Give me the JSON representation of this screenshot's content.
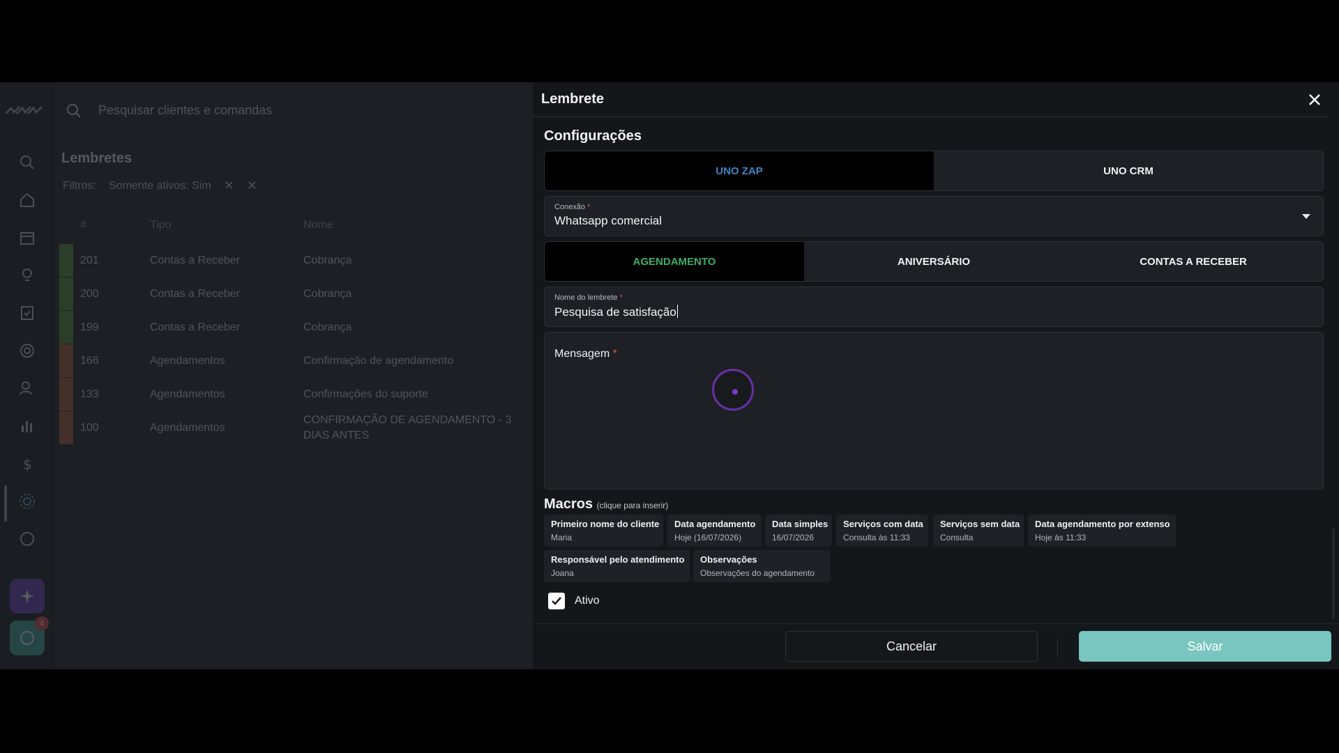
{
  "background": {
    "search_placeholder": "Pesquisar clientes e comandas",
    "page_title": "Lembretes",
    "filters_label": "Filtros:",
    "filter_chip": "Somente ativos: Sim",
    "notification_count": "4",
    "table": {
      "columns": [
        "#",
        "Tipo",
        "Nome"
      ],
      "rows": [
        {
          "id": "201",
          "type": "Contas a Receber",
          "name": "Cobrança",
          "color": "#4f8f3a"
        },
        {
          "id": "200",
          "type": "Contas a Receber",
          "name": "Cobrança",
          "color": "#4f8f3a"
        },
        {
          "id": "199",
          "type": "Contas a Receber",
          "name": "Cobrança",
          "color": "#4f8f3a"
        },
        {
          "id": "166",
          "type": "Agendamentos",
          "name": "Confirmação de agendamento",
          "color": "#b05a3c"
        },
        {
          "id": "133",
          "type": "Agendamentos",
          "name": "Confirmações do suporte",
          "color": "#b05a3c"
        },
        {
          "id": "100",
          "type": "Agendamentos",
          "name": "CONFIRMAÇÃO DE AGENDAMENTO - 3 DIAS ANTES",
          "color": "#b05a3c"
        }
      ]
    }
  },
  "drawer": {
    "title": "Lembrete",
    "section_title": "Configurações",
    "platform_tabs": [
      {
        "label": "UNO ZAP",
        "active": true
      },
      {
        "label": "UNO CRM",
        "active": false
      }
    ],
    "connection": {
      "label": "Conexão",
      "required_mark": "*",
      "value": "Whatsapp comercial"
    },
    "type_tabs": [
      {
        "label": "AGENDAMENTO",
        "active": true
      },
      {
        "label": "ANIVERSÁRIO",
        "active": false
      },
      {
        "label": "CONTAS A RECEBER",
        "active": false
      }
    ],
    "reminder_name": {
      "label": "Nome do lembrete",
      "required_mark": "*",
      "value": "Pesquisa de satisfação"
    },
    "message": {
      "label": "Mensagem",
      "required_mark": "*",
      "value": ""
    },
    "macros": {
      "title": "Macros",
      "hint": "(clique para inserir)",
      "items": [
        {
          "name": "Primeiro nome do cliente",
          "example": "Maria"
        },
        {
          "name": "Data agendamento",
          "example": "Hoje (16/07/2026)"
        },
        {
          "name": "Data simples",
          "example": "16/07/2026"
        },
        {
          "name": "Serviços com data",
          "example": "Consulta às 11:33"
        },
        {
          "name": "Serviços sem data",
          "example": "Consulta"
        },
        {
          "name": "Data agendamento por extenso",
          "example": "Hoje às 11:33"
        },
        {
          "name": "Responsável pelo atendimento",
          "example": "Joana"
        },
        {
          "name": "Observações",
          "example": "Observações do agendamento"
        }
      ]
    },
    "active_checkbox": {
      "label": "Ativo",
      "checked": true
    },
    "cancel_label": "Cancelar",
    "save_label": "Salvar"
  },
  "colors": {
    "zap_tab_active": "#3f86c6",
    "agendamento_tab_active": "#3fae68",
    "save_button": "#79c5bf",
    "required_mark": "#e05353"
  }
}
